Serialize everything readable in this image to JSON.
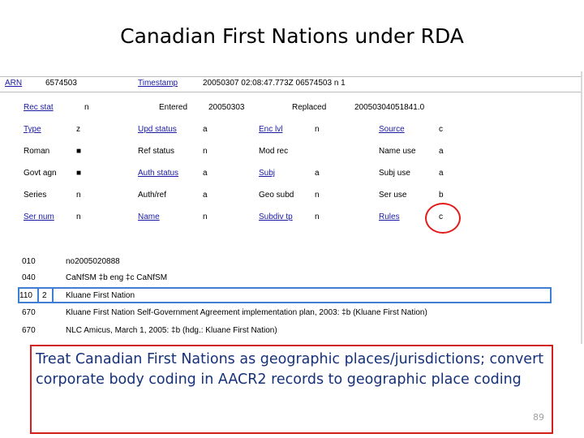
{
  "title": "Canadian First Nations under RDA",
  "header": {
    "arn_label": "ARN",
    "arn_value": "6574503",
    "timestamp_label": "Timestamp",
    "timestamp_value": "20050307 02:08:47.773Z 06574503 n 1"
  },
  "fixed_fields": [
    {
      "label": "Rec stat",
      "link": true,
      "value": "n",
      "label2": "Entered",
      "link2": false,
      "value2": "20050303",
      "label3": "Replaced",
      "link3": false,
      "value3": "20050304051841.0"
    },
    {
      "label": "Type",
      "link": true,
      "value": "z",
      "label2": "Upd status",
      "link2": true,
      "value2": "a",
      "label3": "Enc lvl",
      "link3": true,
      "value3": "n",
      "label4": "Source",
      "link4": true,
      "value4": "c"
    },
    {
      "label": "Roman",
      "link": false,
      "value": "■",
      "label2": "Ref status",
      "link2": false,
      "value2": "n",
      "label3": "Mod rec",
      "link3": false,
      "value3": "",
      "label4": "Name use",
      "link4": false,
      "value4": "a"
    },
    {
      "label": "Govt agn",
      "link": false,
      "value": "■",
      "label2": "Auth status",
      "link2": true,
      "value2": "a",
      "label3": "Subj",
      "link3": true,
      "value3": "a",
      "label4": "Subj use",
      "link4": false,
      "value4": "a"
    },
    {
      "label": "Series",
      "link": false,
      "value": "n",
      "label2": "Auth/ref",
      "link2": false,
      "value2": "a",
      "label3": "Geo subd",
      "link3": false,
      "value3": "n",
      "label4": "Ser use",
      "link4": false,
      "value4": "b"
    },
    {
      "label": "Ser num",
      "link": true,
      "value": "n",
      "label2": "Name",
      "link2": true,
      "value2": "n",
      "label3": "Subdiv tp",
      "link3": true,
      "value3": "n",
      "label4": "Rules",
      "link4": true,
      "value4": "c"
    }
  ],
  "var_fields": [
    {
      "tag": "010",
      "ind": "",
      "content": "no2005020888"
    },
    {
      "tag": "040",
      "ind": "",
      "content": "CaNfSM ‡b eng ‡c CaNfSM"
    },
    {
      "tag": "110",
      "ind": "2",
      "content": "Kluane First Nation"
    },
    {
      "tag": "670",
      "ind": "",
      "content": "Kluane First Nation Self-Government Agreement implementation plan, 2003: ‡b (Kluane First Nation)"
    },
    {
      "tag": "670",
      "ind": "",
      "content": "NLC Amicus, March 1, 2005: ‡b (hdg.: Kluane First Nation)"
    }
  ],
  "note": "Treat Canadian First Nations as geographic places/jurisdictions; convert corporate body coding in AACR2 records to geographic place coding",
  "page_number": "89",
  "colors": {
    "link": "#1a1aa6",
    "highlight_circle": "#e11b1b",
    "highlight_box": "#3e7fd1",
    "note_border": "#d41f1f",
    "note_text": "#16307a"
  }
}
